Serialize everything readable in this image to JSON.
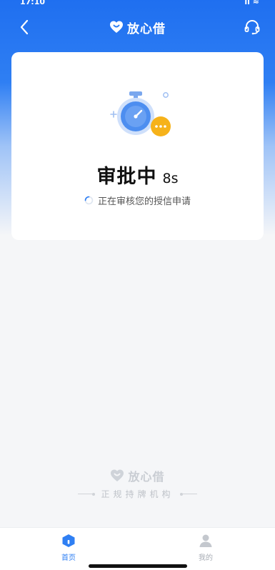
{
  "status_bar": {
    "time": "17:10",
    "right": "ıı ≈"
  },
  "nav": {
    "back_icon": "chevron-left-icon",
    "brand_name": "放心借",
    "brand_logo": "heart-logo-icon",
    "service_icon": "headset-icon"
  },
  "card": {
    "illustration": "stopwatch-icon",
    "status_title": "审批中",
    "countdown": "8s",
    "status_sub": "正在审核您的授信申请"
  },
  "footer": {
    "brand_name": "放心借",
    "slogan": "正规持牌机构"
  },
  "tabbar": {
    "items": [
      {
        "label": "首页",
        "icon": "home-icon",
        "active": true
      },
      {
        "label": "我的",
        "icon": "user-icon",
        "active": false
      }
    ]
  },
  "colors": {
    "primary": "#2f7ff3",
    "illus_orange": "#f6b21a",
    "inactive": "#a8adb5"
  }
}
